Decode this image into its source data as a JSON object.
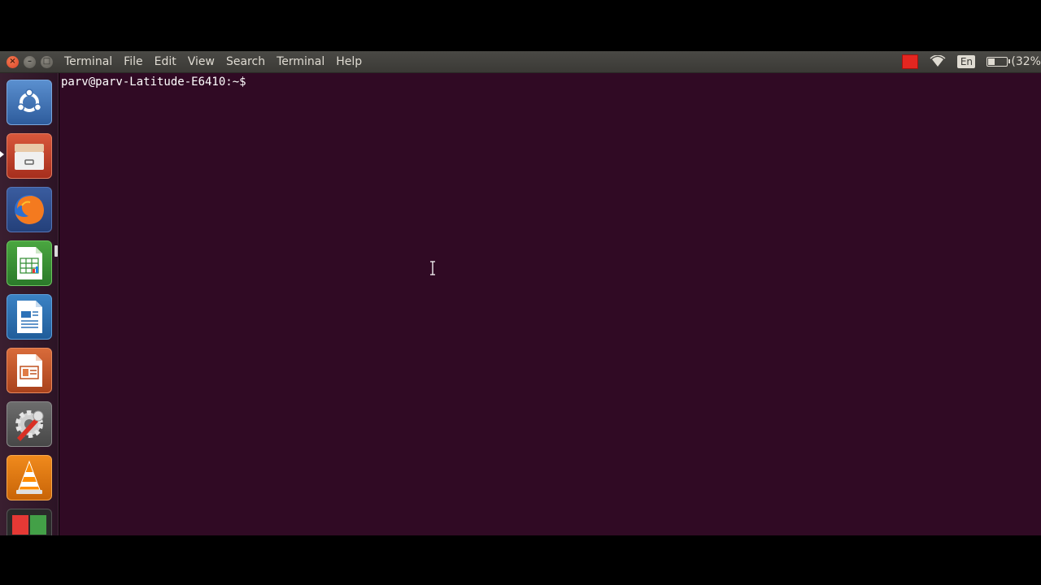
{
  "menubar": {
    "items": [
      "Terminal",
      "File",
      "Edit",
      "View",
      "Search",
      "Terminal",
      "Help"
    ],
    "window_controls": [
      "close-icon",
      "minimize-icon",
      "maximize-icon"
    ]
  },
  "indicators": {
    "language": "En",
    "battery_text": "(32%",
    "battery_level": 0.32,
    "icons": [
      "recording-indicator-icon",
      "wifi-icon",
      "battery-icon"
    ]
  },
  "launcher": {
    "items": [
      {
        "name": "ubuntu-dash",
        "icon": "ubuntu-logo-icon"
      },
      {
        "name": "files",
        "icon": "file-cabinet-icon"
      },
      {
        "name": "firefox",
        "icon": "firefox-icon"
      },
      {
        "name": "libreoffice-calc",
        "icon": "spreadsheet-icon"
      },
      {
        "name": "libreoffice-writer",
        "icon": "document-icon"
      },
      {
        "name": "libreoffice-impress",
        "icon": "presentation-icon"
      },
      {
        "name": "system-settings",
        "icon": "settings-wrench-icon"
      },
      {
        "name": "vlc",
        "icon": "vlc-cone-icon"
      },
      {
        "name": "workspace-switcher",
        "icon": "workspaces-icon"
      }
    ]
  },
  "terminal": {
    "prompt": "parv@parv-Latitude-E6410:~$"
  },
  "colors": {
    "terminal_bg": "#300a24",
    "panel_bg": "#3b3a36",
    "close_button": "#e0502f"
  }
}
